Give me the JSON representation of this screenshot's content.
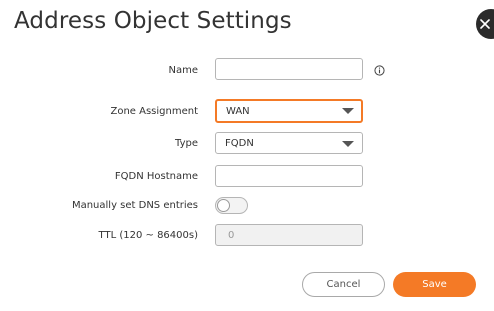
{
  "dialog": {
    "title": "Address Object Settings"
  },
  "form": {
    "name": {
      "label": "Name",
      "value": ""
    },
    "zone_assignment": {
      "label": "Zone Assignment",
      "value": "WAN"
    },
    "type": {
      "label": "Type",
      "value": "FQDN"
    },
    "fqdn_hostname": {
      "label": "FQDN Hostname",
      "value": ""
    },
    "manual_dns": {
      "label": "Manually set DNS entries",
      "on": false
    },
    "ttl": {
      "label": "TTL (120 ~ 86400s)",
      "placeholder": "0"
    }
  },
  "buttons": {
    "cancel": "Cancel",
    "save": "Save"
  },
  "icons": {
    "info": "info-icon",
    "close": "close-icon",
    "dropdown": "chevron-down-icon"
  },
  "colors": {
    "accent": "#f47a26",
    "close_bg": "#2b2b2b"
  }
}
